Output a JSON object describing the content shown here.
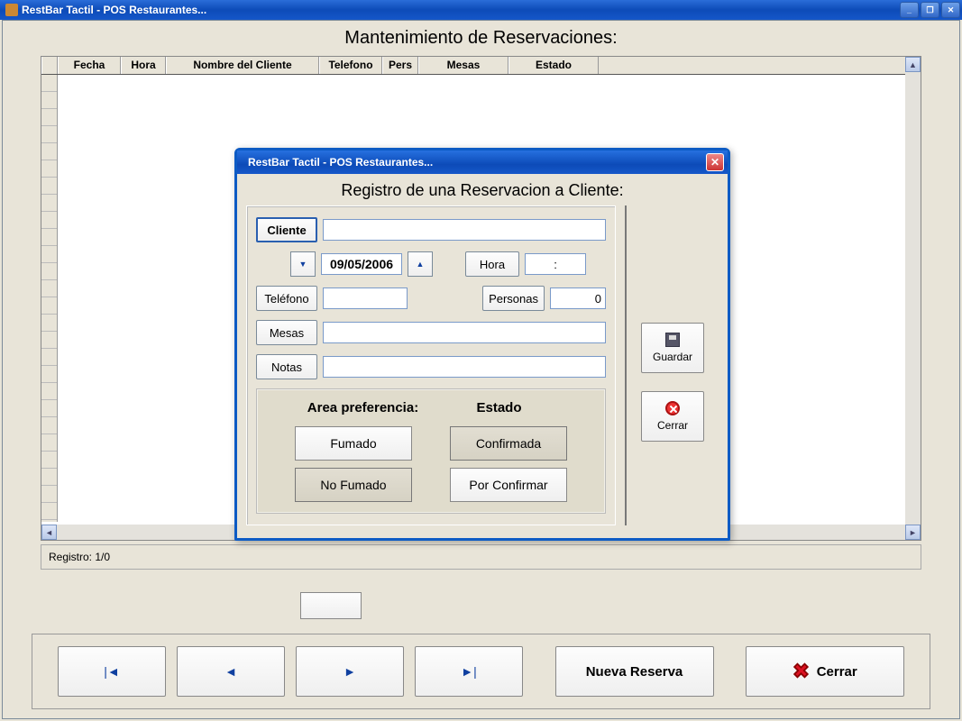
{
  "main_window": {
    "title": "RestBar Tactil - POS Restaurantes...",
    "page_title": "Mantenimiento de Reservaciones:",
    "status": "Registro: 1/0"
  },
  "grid": {
    "columns": {
      "fecha": "Fecha",
      "hora": "Hora",
      "nombre": "Nombre del Cliente",
      "telefono": "Telefono",
      "pers": "Pers",
      "mesas": "Mesas",
      "estado": "Estado"
    }
  },
  "bottom": {
    "nueva": "Nueva Reserva",
    "cerrar": "Cerrar"
  },
  "dialog": {
    "title": "RestBar Tactil - POS Restaurantes...",
    "subtitle": "Registro de una Reservacion a Cliente:",
    "labels": {
      "cliente": "Cliente",
      "hora": "Hora",
      "telefono": "Teléfono",
      "personas": "Personas",
      "mesas": "Mesas",
      "notas": "Notas",
      "area": "Area preferencia:",
      "estado": "Estado"
    },
    "values": {
      "cliente": "",
      "fecha": "09/05/2006",
      "hora": ":",
      "telefono": "",
      "personas": "0",
      "mesas": "",
      "notas": ""
    },
    "area_options": {
      "fumado": "Fumado",
      "no_fumado": "No Fumado"
    },
    "estado_options": {
      "confirmada": "Confirmada",
      "por_confirmar": "Por Confirmar"
    },
    "buttons": {
      "guardar": "Guardar",
      "cerrar": "Cerrar"
    }
  }
}
